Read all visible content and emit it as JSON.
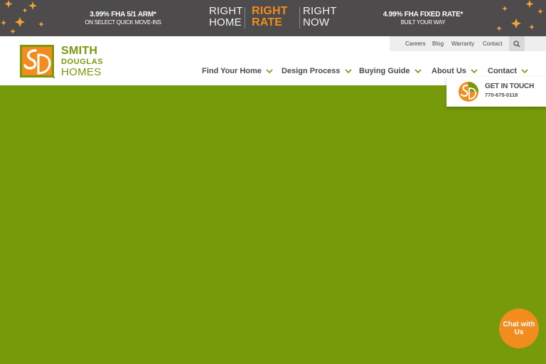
{
  "promo": {
    "left": {
      "title": "3.99% FHA 5/1 ARM*",
      "subtitle": "ON SELECT QUICK MOVE-INS"
    },
    "center": {
      "col1": [
        "RIGHT",
        "HOME"
      ],
      "col2": [
        "RIGHT",
        "RATE"
      ],
      "col3": [
        "RIGHT",
        "NOW"
      ]
    },
    "right": {
      "title": "4.99% FHA FIXED RATE*",
      "subtitle": "BUILT YOUR WAY"
    }
  },
  "utility_nav": [
    "Careers",
    "Blog",
    "Warranty",
    "Contact"
  ],
  "logo": {
    "line1": "SMITH",
    "line2": "DOUGLAS",
    "line3": "HOMES"
  },
  "main_nav": [
    "Find Your Home",
    "Design Process",
    "Buying Guide",
    "About Us",
    "Contact"
  ],
  "get_in_touch": {
    "title": "GET IN TOUCH",
    "phone": "770-675-0118"
  },
  "chat": {
    "line1": "Chat with",
    "line2": "Us"
  },
  "colors": {
    "brand_green": "#779a0b",
    "brand_orange": "#f28c1e",
    "banner_gray": "#4d4b4c"
  },
  "icons": [
    "sparkle-icon",
    "search-icon",
    "chevron-down-icon",
    "sd-monogram-icon"
  ]
}
